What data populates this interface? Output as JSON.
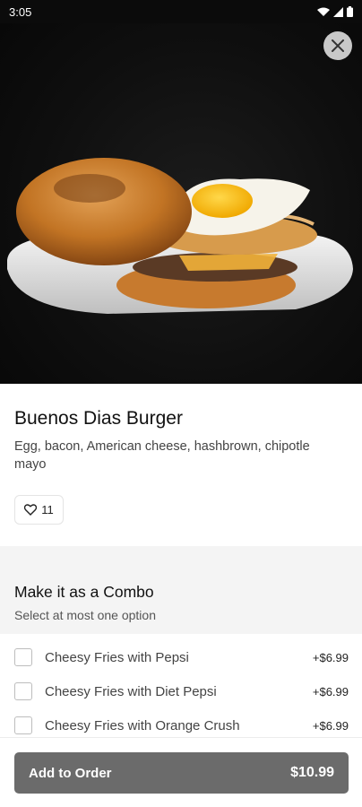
{
  "status_bar": {
    "time": "3:05"
  },
  "item": {
    "title": "Buenos Dias Burger",
    "description": "Egg, bacon, American cheese, hashbrown, chipotle mayo",
    "likes": "11"
  },
  "combo": {
    "title": "Make it as a Combo",
    "subtitle": "Select at most one option",
    "options": [
      {
        "label": "Cheesy Fries with Pepsi",
        "price": "+$6.99",
        "checked": false
      },
      {
        "label": "Cheesy Fries with Diet Pepsi",
        "price": "+$6.99",
        "checked": false
      },
      {
        "label": "Cheesy Fries with Orange Crush",
        "price": "+$6.99",
        "checked": false
      }
    ]
  },
  "cta": {
    "label": "Add to Order",
    "price": "$10.99"
  },
  "colors": {
    "button": "#6b6b6b",
    "hero_bg": "#0f0f0f"
  },
  "icons": [
    "wifi-icon",
    "cellular-icon",
    "battery-icon",
    "close-icon",
    "heart-icon"
  ]
}
